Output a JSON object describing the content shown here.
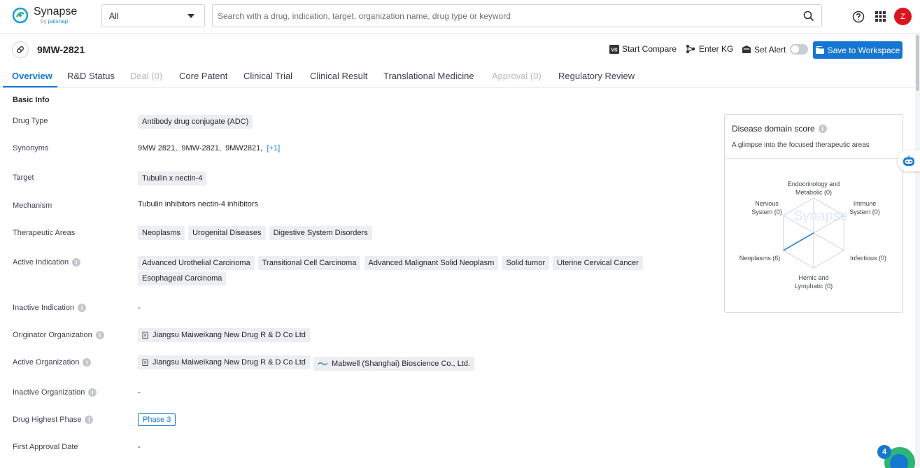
{
  "brand": {
    "name": "Synapse",
    "by": "by",
    "by_brand": "patsnap"
  },
  "search": {
    "scope": "All",
    "placeholder": "Search with a drug, indication, target, organization name, drug type or keyword"
  },
  "user": {
    "avatar_letter": "Z"
  },
  "drug": {
    "name": "9MW-2821"
  },
  "actions": {
    "compare": "Start Compare",
    "kg": "Enter KG",
    "alert": "Set Alert",
    "save": "Save to Workspace"
  },
  "tabs": [
    {
      "label": "Overview",
      "state": "active"
    },
    {
      "label": "R&D Status",
      "state": "normal"
    },
    {
      "label": "Deal (0)",
      "state": "disabled"
    },
    {
      "label": "Core Patent",
      "state": "normal"
    },
    {
      "label": "Clinical Trial",
      "state": "normal"
    },
    {
      "label": "Clinical Result",
      "state": "normal"
    },
    {
      "label": "Translational Medicine",
      "state": "normal"
    },
    {
      "label": "Approval (0)",
      "state": "disabled"
    },
    {
      "label": "Regulatory Review",
      "state": "normal"
    }
  ],
  "basic_info": {
    "title": "Basic Info",
    "drug_type": {
      "label": "Drug Type",
      "value": "Antibody drug conjugate (ADC)"
    },
    "synonyms": {
      "label": "Synonyms",
      "values": [
        "9MW 2821,",
        "9MW-2821,",
        "9MW2821,"
      ],
      "more": "[+1]"
    },
    "target": {
      "label": "Target",
      "value": "Tubulin x nectin-4"
    },
    "mechanism": {
      "label": "Mechanism",
      "value": "Tubulin inhibitors  nectin-4 inhibitors"
    },
    "therapeutic_areas": {
      "label": "Therapeutic Areas",
      "values": [
        "Neoplasms",
        "Urogenital Diseases",
        "Digestive System Disorders"
      ]
    },
    "active_indication": {
      "label": "Active Indication",
      "values": [
        "Advanced Urothelial Carcinoma",
        "Transitional Cell Carcinoma",
        "Advanced Malignant Solid Neoplasm",
        "Solid tumor",
        "Uterine Cervical Cancer",
        "Esophageal Carcinoma"
      ]
    },
    "inactive_indication": {
      "label": "Inactive Indication",
      "value": "-"
    },
    "originator_org": {
      "label": "Originator Organization",
      "value": "Jiangsu Maiweikang New Drug R & D Co Ltd"
    },
    "active_org": {
      "label": "Active Organization",
      "values": [
        "Jiangsu Maiweikang New Drug R & D Co Ltd",
        "Mabwell (Shanghai) Bioscience Co., Ltd."
      ]
    },
    "inactive_org": {
      "label": "Inactive Organization",
      "value": "-"
    },
    "highest_phase": {
      "label": "Drug Highest Phase",
      "value": "Phase 3"
    },
    "first_approval": {
      "label": "First Approval Date",
      "value": "-"
    }
  },
  "disease_domain": {
    "title": "Disease domain score",
    "subtitle": "A glimpse into the focused therapeutic areas",
    "axes": [
      {
        "label_line1": "Endocrinology and",
        "label_line2": "Metabolic (0)",
        "score": 0
      },
      {
        "label_line1": "Immune",
        "label_line2": "System (0)",
        "score": 0
      },
      {
        "label_line1": "Infectious (0)",
        "label_line2": "",
        "score": 0
      },
      {
        "label_line1": "Hemic and",
        "label_line2": "Lymphatic (0)",
        "score": 0
      },
      {
        "label_line1": "Neoplasms (6)",
        "label_line2": "",
        "score": 6
      },
      {
        "label_line1": "Nervous",
        "label_line2": "System (0)",
        "score": 0
      }
    ],
    "max_score": 6,
    "watermark": "Synapse"
  },
  "notifications": {
    "count": "4"
  },
  "colors": {
    "accent": "#1677d2",
    "avatar": "#d9141e"
  }
}
